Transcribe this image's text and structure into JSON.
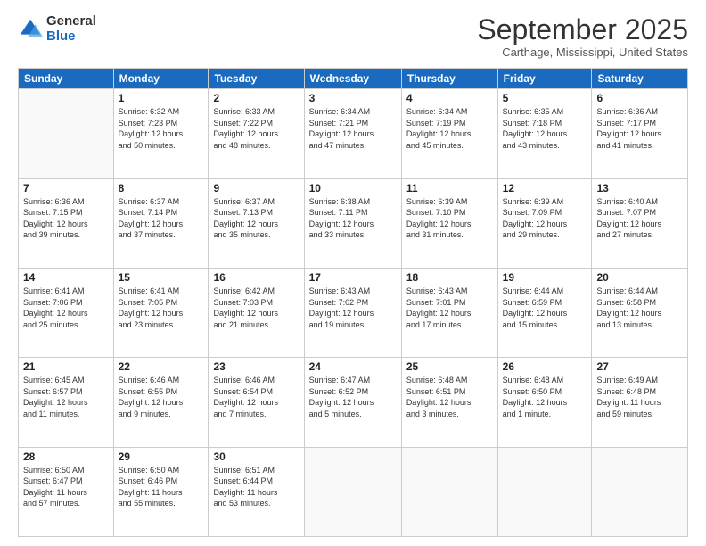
{
  "logo": {
    "general": "General",
    "blue": "Blue"
  },
  "header": {
    "month": "September 2025",
    "location": "Carthage, Mississippi, United States"
  },
  "weekdays": [
    "Sunday",
    "Monday",
    "Tuesday",
    "Wednesday",
    "Thursday",
    "Friday",
    "Saturday"
  ],
  "weeks": [
    [
      {
        "day": "",
        "info": ""
      },
      {
        "day": "1",
        "info": "Sunrise: 6:32 AM\nSunset: 7:23 PM\nDaylight: 12 hours\nand 50 minutes."
      },
      {
        "day": "2",
        "info": "Sunrise: 6:33 AM\nSunset: 7:22 PM\nDaylight: 12 hours\nand 48 minutes."
      },
      {
        "day": "3",
        "info": "Sunrise: 6:34 AM\nSunset: 7:21 PM\nDaylight: 12 hours\nand 47 minutes."
      },
      {
        "day": "4",
        "info": "Sunrise: 6:34 AM\nSunset: 7:19 PM\nDaylight: 12 hours\nand 45 minutes."
      },
      {
        "day": "5",
        "info": "Sunrise: 6:35 AM\nSunset: 7:18 PM\nDaylight: 12 hours\nand 43 minutes."
      },
      {
        "day": "6",
        "info": "Sunrise: 6:36 AM\nSunset: 7:17 PM\nDaylight: 12 hours\nand 41 minutes."
      }
    ],
    [
      {
        "day": "7",
        "info": "Sunrise: 6:36 AM\nSunset: 7:15 PM\nDaylight: 12 hours\nand 39 minutes."
      },
      {
        "day": "8",
        "info": "Sunrise: 6:37 AM\nSunset: 7:14 PM\nDaylight: 12 hours\nand 37 minutes."
      },
      {
        "day": "9",
        "info": "Sunrise: 6:37 AM\nSunset: 7:13 PM\nDaylight: 12 hours\nand 35 minutes."
      },
      {
        "day": "10",
        "info": "Sunrise: 6:38 AM\nSunset: 7:11 PM\nDaylight: 12 hours\nand 33 minutes."
      },
      {
        "day": "11",
        "info": "Sunrise: 6:39 AM\nSunset: 7:10 PM\nDaylight: 12 hours\nand 31 minutes."
      },
      {
        "day": "12",
        "info": "Sunrise: 6:39 AM\nSunset: 7:09 PM\nDaylight: 12 hours\nand 29 minutes."
      },
      {
        "day": "13",
        "info": "Sunrise: 6:40 AM\nSunset: 7:07 PM\nDaylight: 12 hours\nand 27 minutes."
      }
    ],
    [
      {
        "day": "14",
        "info": "Sunrise: 6:41 AM\nSunset: 7:06 PM\nDaylight: 12 hours\nand 25 minutes."
      },
      {
        "day": "15",
        "info": "Sunrise: 6:41 AM\nSunset: 7:05 PM\nDaylight: 12 hours\nand 23 minutes."
      },
      {
        "day": "16",
        "info": "Sunrise: 6:42 AM\nSunset: 7:03 PM\nDaylight: 12 hours\nand 21 minutes."
      },
      {
        "day": "17",
        "info": "Sunrise: 6:43 AM\nSunset: 7:02 PM\nDaylight: 12 hours\nand 19 minutes."
      },
      {
        "day": "18",
        "info": "Sunrise: 6:43 AM\nSunset: 7:01 PM\nDaylight: 12 hours\nand 17 minutes."
      },
      {
        "day": "19",
        "info": "Sunrise: 6:44 AM\nSunset: 6:59 PM\nDaylight: 12 hours\nand 15 minutes."
      },
      {
        "day": "20",
        "info": "Sunrise: 6:44 AM\nSunset: 6:58 PM\nDaylight: 12 hours\nand 13 minutes."
      }
    ],
    [
      {
        "day": "21",
        "info": "Sunrise: 6:45 AM\nSunset: 6:57 PM\nDaylight: 12 hours\nand 11 minutes."
      },
      {
        "day": "22",
        "info": "Sunrise: 6:46 AM\nSunset: 6:55 PM\nDaylight: 12 hours\nand 9 minutes."
      },
      {
        "day": "23",
        "info": "Sunrise: 6:46 AM\nSunset: 6:54 PM\nDaylight: 12 hours\nand 7 minutes."
      },
      {
        "day": "24",
        "info": "Sunrise: 6:47 AM\nSunset: 6:52 PM\nDaylight: 12 hours\nand 5 minutes."
      },
      {
        "day": "25",
        "info": "Sunrise: 6:48 AM\nSunset: 6:51 PM\nDaylight: 12 hours\nand 3 minutes."
      },
      {
        "day": "26",
        "info": "Sunrise: 6:48 AM\nSunset: 6:50 PM\nDaylight: 12 hours\nand 1 minute."
      },
      {
        "day": "27",
        "info": "Sunrise: 6:49 AM\nSunset: 6:48 PM\nDaylight: 11 hours\nand 59 minutes."
      }
    ],
    [
      {
        "day": "28",
        "info": "Sunrise: 6:50 AM\nSunset: 6:47 PM\nDaylight: 11 hours\nand 57 minutes."
      },
      {
        "day": "29",
        "info": "Sunrise: 6:50 AM\nSunset: 6:46 PM\nDaylight: 11 hours\nand 55 minutes."
      },
      {
        "day": "30",
        "info": "Sunrise: 6:51 AM\nSunset: 6:44 PM\nDaylight: 11 hours\nand 53 minutes."
      },
      {
        "day": "",
        "info": ""
      },
      {
        "day": "",
        "info": ""
      },
      {
        "day": "",
        "info": ""
      },
      {
        "day": "",
        "info": ""
      }
    ]
  ]
}
